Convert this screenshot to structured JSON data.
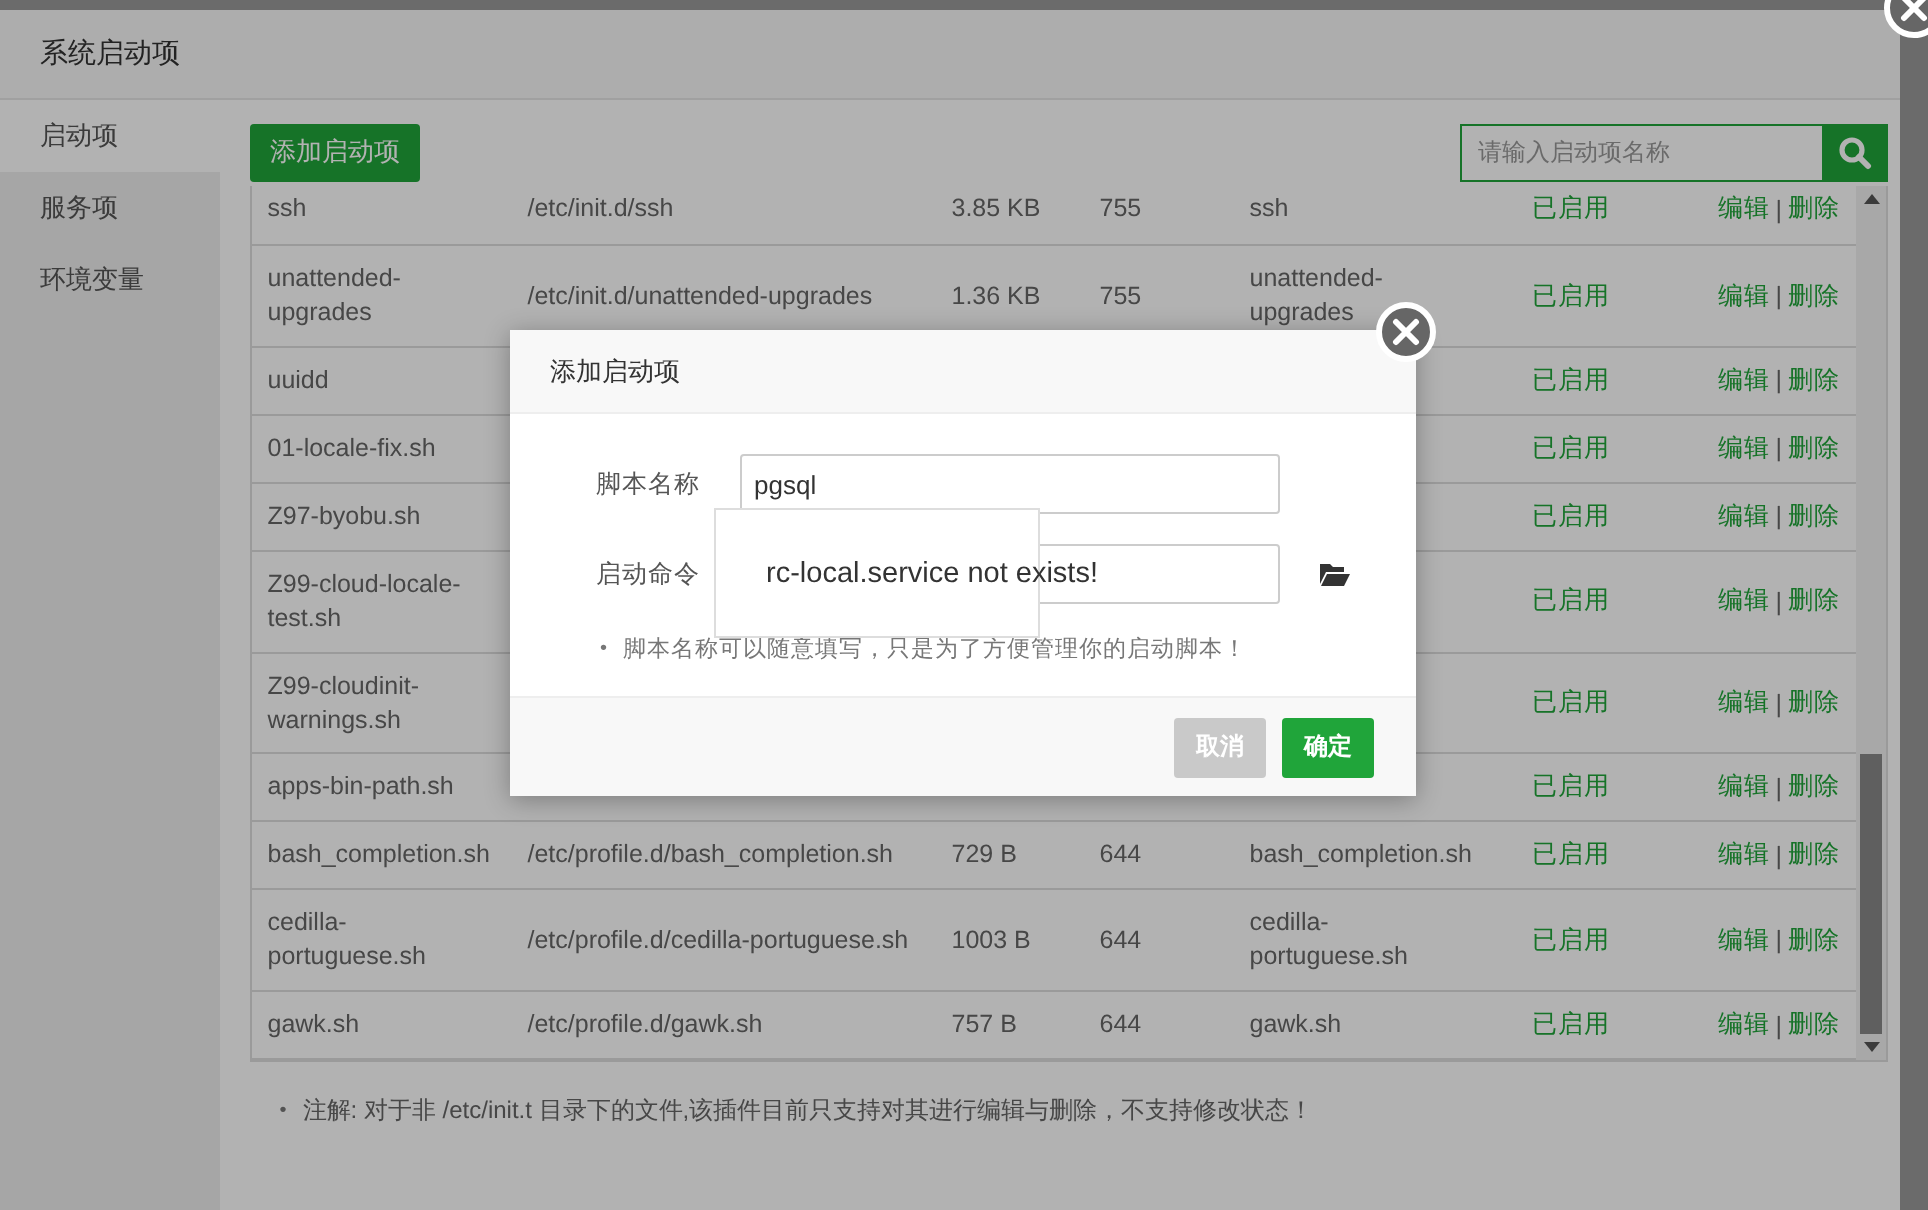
{
  "window": {
    "title": "系统启动项"
  },
  "sidebar": {
    "items": [
      {
        "label": "启动项",
        "selected": true
      },
      {
        "label": "服务项",
        "selected": false
      },
      {
        "label": "环境变量",
        "selected": false
      }
    ]
  },
  "toolbar": {
    "add_button": "添加启动项",
    "search": {
      "placeholder": "请输入启动项名称"
    }
  },
  "table": {
    "rows": [
      {
        "name": "ssh",
        "path": "/etc/init.d/ssh",
        "size": "3.85 KB",
        "permission": "755",
        "script": "ssh",
        "status": "已启用",
        "actions": [
          "编辑",
          "删除"
        ],
        "separator": "|"
      },
      {
        "name": "unattended-upgrades",
        "path": "/etc/init.d/unattended-upgrades",
        "size": "1.36 KB",
        "permission": "755",
        "script": "unattended-upgrades",
        "status": "已启用",
        "actions": [
          "编辑",
          "删除"
        ],
        "separator": "|"
      },
      {
        "name": "uuidd",
        "status": "已启用",
        "actions": [
          "编辑",
          "删除"
        ],
        "separator": "|"
      },
      {
        "name": "01-locale-fix.sh",
        "status": "已启用",
        "actions": [
          "编辑",
          "删除"
        ],
        "separator": "|"
      },
      {
        "name": "Z97-byobu.sh",
        "status": "已启用",
        "actions": [
          "编辑",
          "删除"
        ],
        "separator": "|"
      },
      {
        "name": "Z99-cloud-locale-test.sh",
        "status": "已启用",
        "actions": [
          "编辑",
          "删除"
        ],
        "separator": "|"
      },
      {
        "name": "Z99-cloudinit-warnings.sh",
        "status": "已启用",
        "actions": [
          "编辑",
          "删除"
        ],
        "separator": "|"
      },
      {
        "name": "apps-bin-path.sh",
        "status": "已启用",
        "actions": [
          "编辑",
          "删除"
        ],
        "separator": "|"
      },
      {
        "name": "bash_completion.sh",
        "path": "/etc/profile.d/bash_completion.sh",
        "size": "729 B",
        "permission": "644",
        "script": "bash_completion.sh",
        "status": "已启用",
        "actions": [
          "编辑",
          "删除"
        ],
        "separator": "|"
      },
      {
        "name": "cedilla-portuguese.sh",
        "path": "/etc/profile.d/cedilla-portuguese.sh",
        "size": "1003 B",
        "permission": "644",
        "script": "cedilla-portuguese.sh",
        "status": "已启用",
        "actions": [
          "编辑",
          "删除"
        ],
        "separator": "|"
      },
      {
        "name": "gawk.sh",
        "path": "/etc/profile.d/gawk.sh",
        "size": "757 B",
        "permission": "644",
        "script": "gawk.sh",
        "status": "已启用",
        "actions": [
          "编辑",
          "删除"
        ],
        "separator": "|"
      }
    ]
  },
  "note_bullet": "•",
  "note": "注解: 对于非 /etc/init.t 目录下的文件,该插件目前只支持对其进行编辑与删除，不支持修改状态！",
  "dialog": {
    "title": "添加启动项",
    "fields": [
      {
        "label": "脚本名称",
        "value": "pgsql"
      },
      {
        "label": "启动命令"
      }
    ],
    "hint_bullet": "•",
    "hint": "脚本名称可以随意填写，只是为了方便管理你的启动脚本！",
    "buttons": [
      {
        "label": "取消",
        "kind": "cancel"
      },
      {
        "label": "确定",
        "kind": "confirm"
      }
    ]
  },
  "toast": {
    "message": "rc-local.service not exists!"
  }
}
